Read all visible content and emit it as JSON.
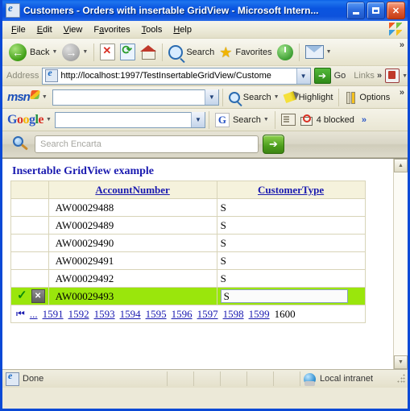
{
  "window": {
    "title": "Customers - Orders with insertable GridView - Microsoft Intern...",
    "icon": "ie-document-icon",
    "minimize_label": "Minimize",
    "maximize_label": "Maximize",
    "close_label": "Close"
  },
  "menu": {
    "items": [
      {
        "label": "File",
        "accesskey": "F"
      },
      {
        "label": "Edit",
        "accesskey": "E"
      },
      {
        "label": "View",
        "accesskey": "V"
      },
      {
        "label": "Favorites",
        "accesskey": "a"
      },
      {
        "label": "Tools",
        "accesskey": "T"
      },
      {
        "label": "Help",
        "accesskey": "H"
      }
    ]
  },
  "toolbar": {
    "back_label": "Back",
    "forward_label": "Forward",
    "stop_label": "Stop",
    "refresh_label": "Refresh",
    "home_label": "Home",
    "search_label": "Search",
    "favorites_label": "Favorites",
    "history_label": "History",
    "mail_label": "Mail",
    "overflow_label": "»"
  },
  "address_bar": {
    "label": "Address",
    "url": "http://localhost:1997/TestInsertableGridView/Custome",
    "go_label": "Go",
    "links_label": "Links",
    "overflow_label": "»"
  },
  "msn_toolbar": {
    "brand": "msn",
    "search_value": "",
    "search_label": "Search",
    "highlight_label": "Highlight",
    "options_label": "Options",
    "overflow_label": "»"
  },
  "google_toolbar": {
    "brand_letters": [
      "G",
      "o",
      "o",
      "g",
      "l",
      "e"
    ],
    "search_value": "",
    "search_label": "Search",
    "g_mark": "G",
    "blocked_label": "4 blocked",
    "overflow_label": "»"
  },
  "encarta_toolbar": {
    "placeholder": "Search Encarta",
    "value": "",
    "go_label": "➔"
  },
  "page": {
    "heading": "Insertable GridView example",
    "grid": {
      "columns": [
        "",
        "AccountNumber",
        "CustomerType"
      ],
      "rows": [
        {
          "commands": "",
          "account_number": "AW00029488",
          "customer_type": "S",
          "editing": false
        },
        {
          "commands": "",
          "account_number": "AW00029489",
          "customer_type": "S",
          "editing": false
        },
        {
          "commands": "",
          "account_number": "AW00029490",
          "customer_type": "S",
          "editing": false
        },
        {
          "commands": "",
          "account_number": "AW00029491",
          "customer_type": "S",
          "editing": false
        },
        {
          "commands": "",
          "account_number": "AW00029492",
          "customer_type": "S",
          "editing": false
        }
      ],
      "edit_row": {
        "update_icon": "✓",
        "cancel_icon": "✕",
        "account_number": "AW00029493",
        "customer_type_value": "S"
      },
      "pager": {
        "first_icon": "⏮",
        "ellipsis": "...",
        "pages": [
          "1591",
          "1592",
          "1593",
          "1594",
          "1595",
          "1596",
          "1597",
          "1598",
          "1599"
        ],
        "current_page": "1600"
      }
    }
  },
  "status_bar": {
    "status": "Done",
    "zone": "Local intranet"
  },
  "colors": {
    "titlebar_blue": "#0d52dc",
    "edit_row_green": "#9ae60c",
    "link_blue": "#1a1ab0",
    "header_cream": "#f5f2dc"
  }
}
